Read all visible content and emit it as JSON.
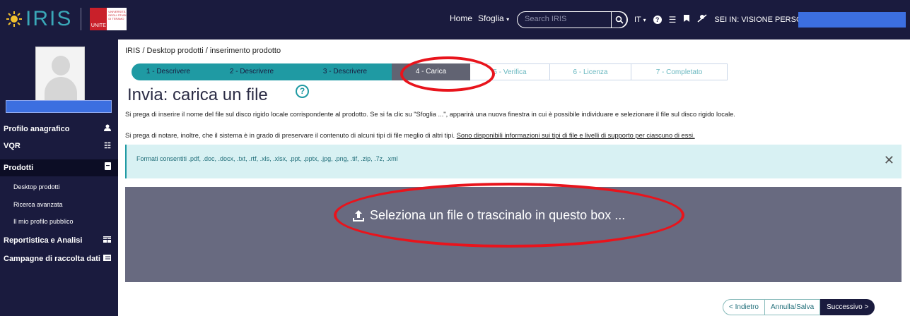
{
  "header": {
    "logo_text": "IRIS",
    "unite_label": "UNITE",
    "unite_small": "UNIVERSITÀ DEGLI STUDI DI TERAMO",
    "nav_home": "Home",
    "nav_browse": "Sfoglia",
    "search_placeholder": "Search IRIS",
    "language": "IT",
    "session_label": "SEI IN: VISIONE PERSONALE"
  },
  "sidebar": {
    "items": [
      {
        "label": "Profilo anagrafico"
      },
      {
        "label": "VQR"
      },
      {
        "label": "Prodotti"
      },
      {
        "label": "Desktop prodotti"
      },
      {
        "label": "Ricerca avanzata"
      },
      {
        "label": "Il mio profilo pubblico"
      },
      {
        "label": "Reportistica e Analisi"
      },
      {
        "label": "Campagne di raccolta dati"
      }
    ]
  },
  "breadcrumb": "IRIS / Desktop prodotti / inserimento prodotto",
  "steps": [
    {
      "label": "1 - Descrivere"
    },
    {
      "label": "2 - Descrivere"
    },
    {
      "label": "3 - Descrivere"
    },
    {
      "label": "4 - Carica"
    },
    {
      "label": "5 - Verifica"
    },
    {
      "label": "6 - Licenza"
    },
    {
      "label": "7 - Completato"
    }
  ],
  "main": {
    "title": "Invia: carica un file",
    "help_glyph": "?",
    "para1": "Si prega di inserire il nome del file sul disco rigido locale corrispondente al prodotto. Se si fa clic su \"Sfoglia ...\", apparirà una nuova finestra in cui è possibile individuare e selezionare il file sul disco rigido locale.",
    "para2": "Si prega di notare, inoltre, che il sistema è in grado di preservare il contenuto di alcuni tipi di file meglio di altri tipi.",
    "para2_link": "Sono disponibili informazioni sui tipi di file e livelli di supporto per ciascuno di essi.",
    "alert": "Formati consentiti .pdf, .doc, .docx, .txt, .rtf, .xls, .xlsx, .ppt, .pptx, .jpg, .png, .tif, .zip, .7z, .xml",
    "dropzone_label": "Seleziona un file o trascinalo in questo box ..."
  },
  "footer": {
    "back": "< Indietro",
    "cancel": "Annulla/Salva",
    "next": "Successivo >"
  },
  "colors": {
    "navy": "#1a1b3e",
    "teal": "#1f9aa3",
    "dropzone": "#686a80",
    "highlight": "#e8141c"
  }
}
